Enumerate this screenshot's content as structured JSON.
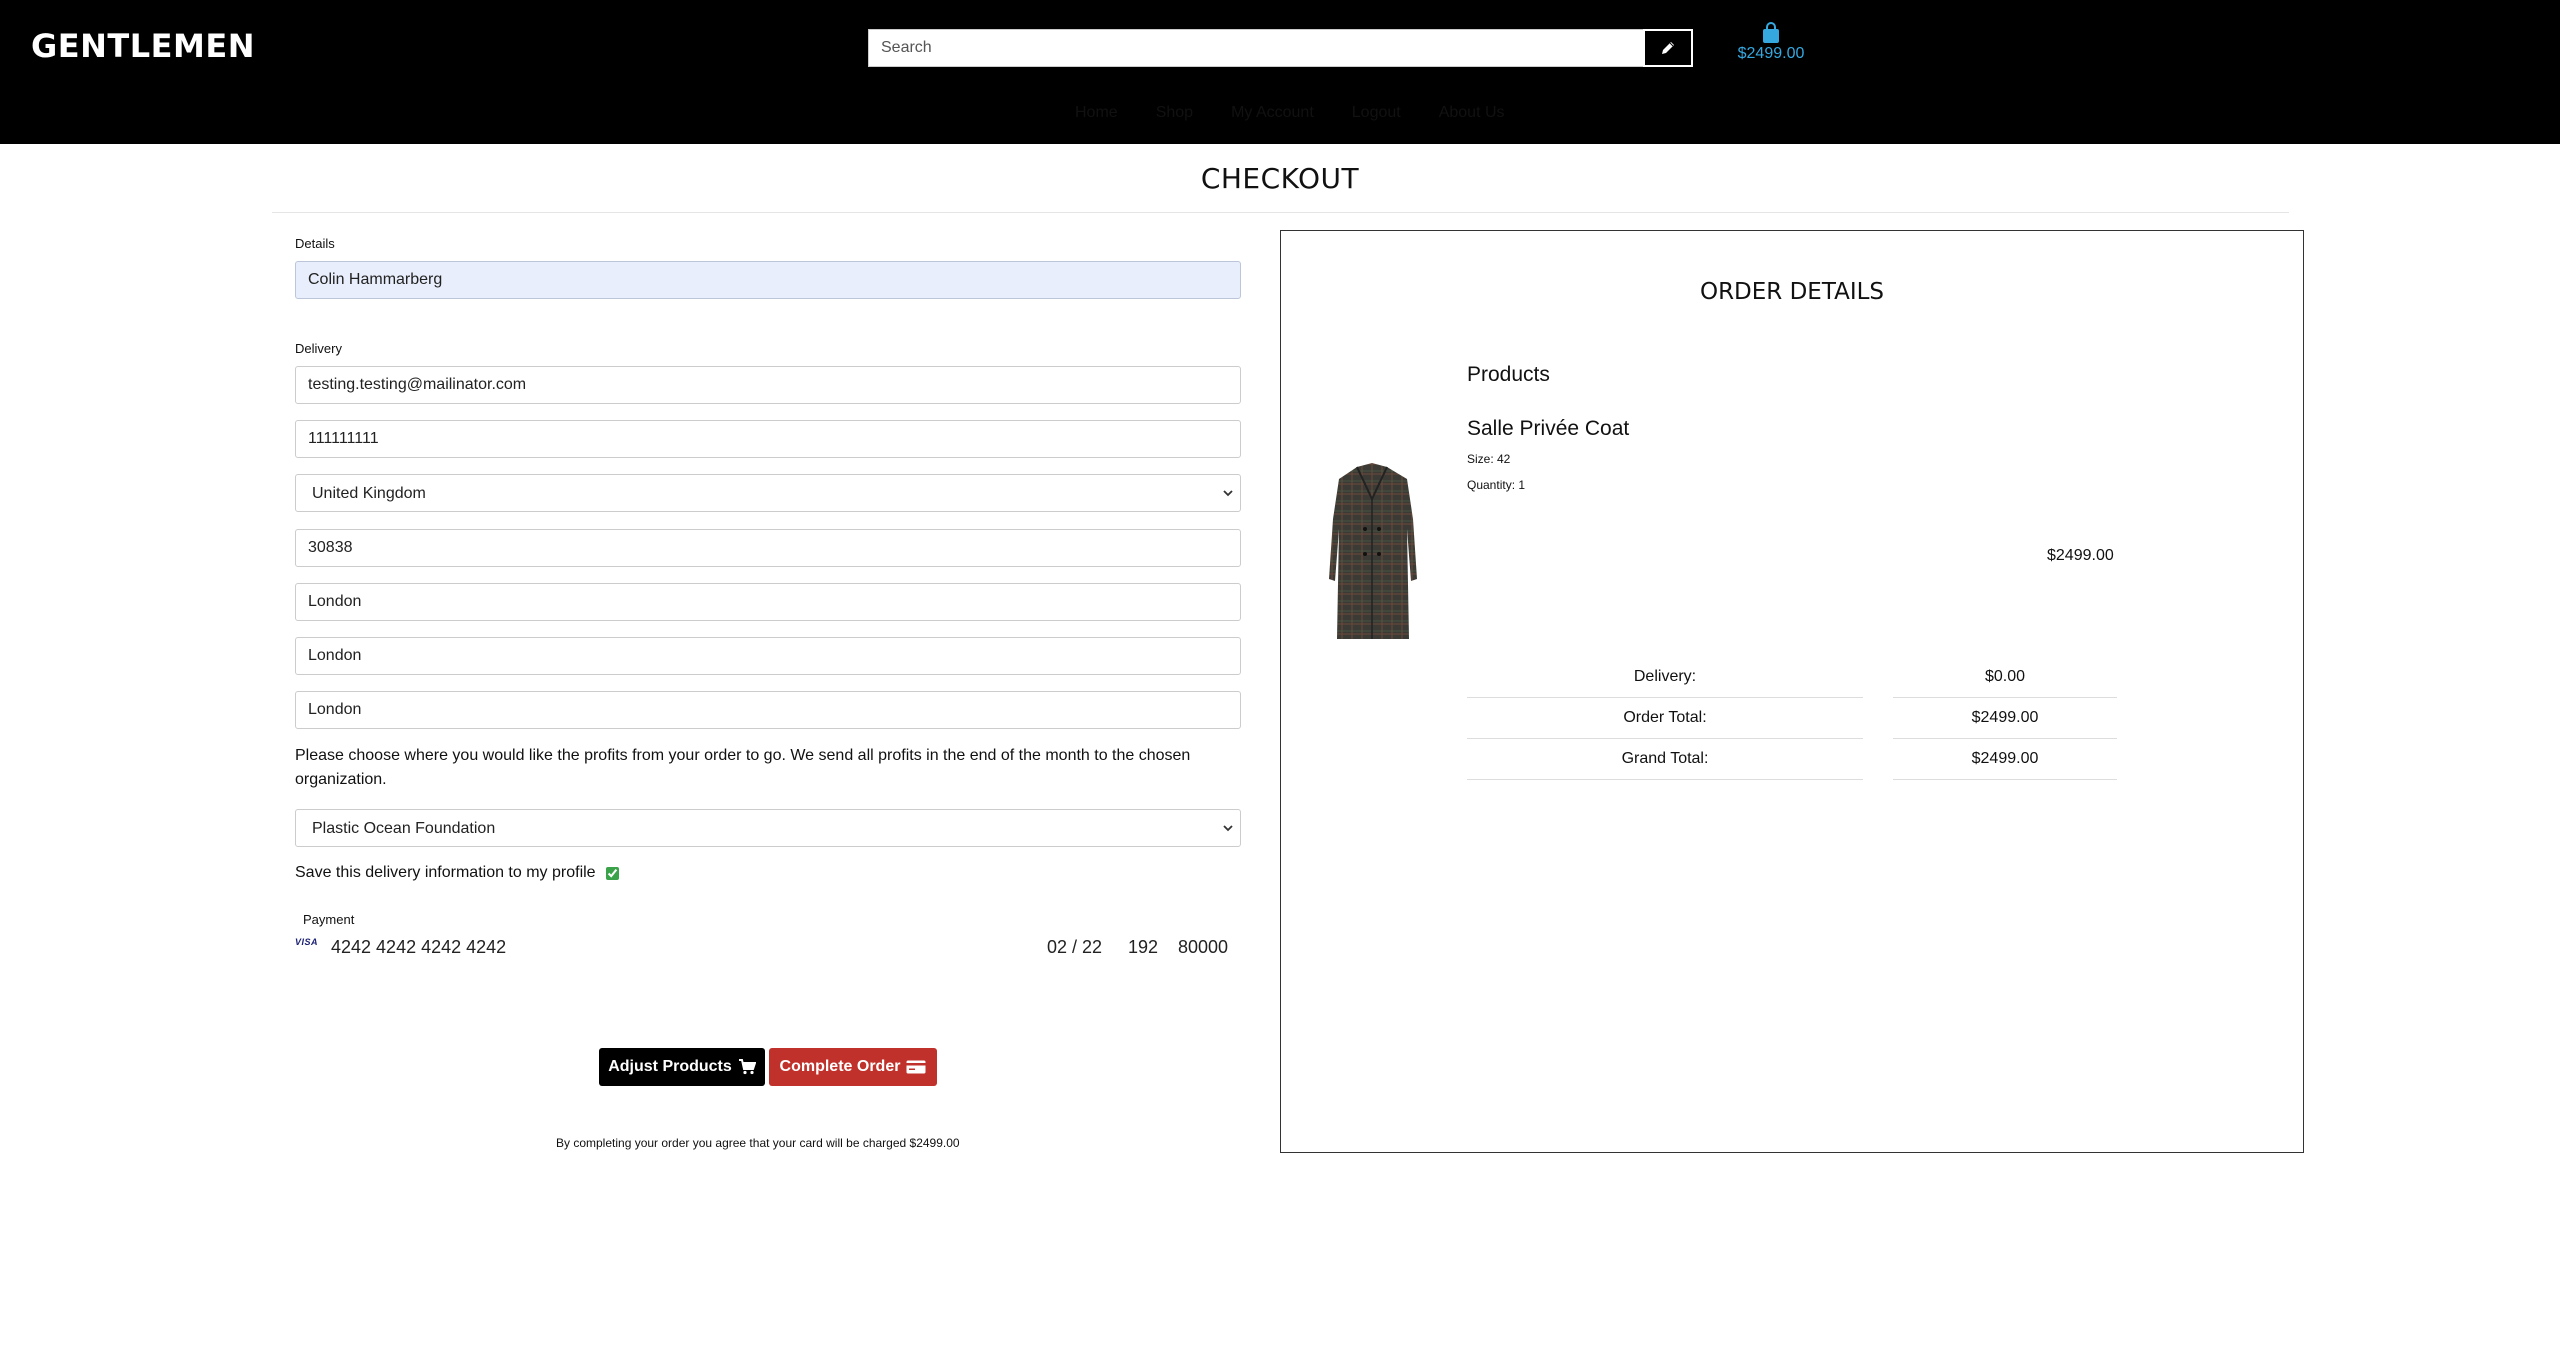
{
  "header": {
    "logo": "GENTLEMEN",
    "search_placeholder": "Search",
    "cart_total": "$2499.00",
    "nav": [
      "Home",
      "Shop",
      "My Account",
      "Logout",
      "About Us"
    ]
  },
  "page_title": "CHECKOUT",
  "form": {
    "details_label": "Details",
    "full_name": "Colin Hammarberg",
    "delivery_label": "Delivery",
    "email": "testing.testing@mailinator.com",
    "phone": "111111111",
    "country": "United Kingdom",
    "postcode": "30838",
    "town": "London",
    "street1": "London",
    "street2": "London",
    "charity_text": "Please choose where you would like the profits from your order to go. We send all profits in the end of the month to the chosen organization.",
    "charity": "Plastic Ocean Foundation",
    "save_label": "Save this delivery information to my profile",
    "payment_label": "Payment",
    "card_brand": "VISA",
    "card_number": "4242 4242 4242 4242",
    "card_expiry": "02 / 22",
    "card_cvc": "192",
    "card_zip": "80000",
    "adjust_button": "Adjust Products",
    "complete_button": "Complete Order",
    "agree_text": "By completing your order you agree that your card will be charged $2499.00"
  },
  "order": {
    "title": "ORDER DETAILS",
    "products_heading": "Products",
    "product_name": "Salle Privée Coat",
    "size": "Size: 42",
    "quantity": "Quantity: 1",
    "price": "$2499.00",
    "delivery_label": "Delivery:",
    "delivery_value": "$0.00",
    "order_total_label": "Order Total:",
    "order_total_value": "$2499.00",
    "grand_total_label": "Grand Total:",
    "grand_total_value": "$2499.00"
  },
  "icons": {
    "search_button": "pencil-icon",
    "cart": "shopping-bag-icon",
    "adjust": "shopping-cart-icon",
    "complete": "credit-card-icon"
  },
  "colors": {
    "header_bg": "#000000",
    "cart_accent": "#35a8e0",
    "complete_button": "#c0312b",
    "highlight_field": "#e8eefb"
  }
}
